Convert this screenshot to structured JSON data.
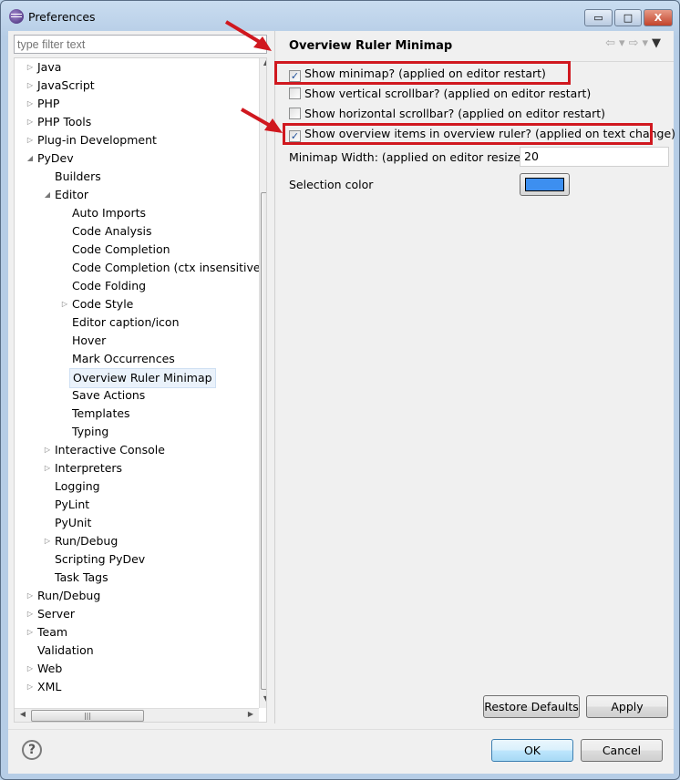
{
  "window": {
    "title": "Preferences",
    "minimize": "▭",
    "maximize": "□",
    "close": "X"
  },
  "filter": {
    "placeholder": "type filter text"
  },
  "tree": [
    {
      "label": "Java",
      "level": 0,
      "toggle": "collapsed"
    },
    {
      "label": "JavaScript",
      "level": 0,
      "toggle": "collapsed"
    },
    {
      "label": "PHP",
      "level": 0,
      "toggle": "collapsed"
    },
    {
      "label": "PHP Tools",
      "level": 0,
      "toggle": "collapsed"
    },
    {
      "label": "Plug-in Development",
      "level": 0,
      "toggle": "collapsed"
    },
    {
      "label": "PyDev",
      "level": 0,
      "toggle": "expanded"
    },
    {
      "label": "Builders",
      "level": 1,
      "toggle": "none"
    },
    {
      "label": "Editor",
      "level": 1,
      "toggle": "expanded"
    },
    {
      "label": "Auto Imports",
      "level": 2,
      "toggle": "none"
    },
    {
      "label": "Code Analysis",
      "level": 2,
      "toggle": "none"
    },
    {
      "label": "Code Completion",
      "level": 2,
      "toggle": "none"
    },
    {
      "label": "Code Completion (ctx insensitive a",
      "level": 2,
      "toggle": "none"
    },
    {
      "label": "Code Folding",
      "level": 2,
      "toggle": "none"
    },
    {
      "label": "Code Style",
      "level": 2,
      "toggle": "collapsed"
    },
    {
      "label": "Editor caption/icon",
      "level": 2,
      "toggle": "none"
    },
    {
      "label": "Hover",
      "level": 2,
      "toggle": "none"
    },
    {
      "label": "Mark Occurrences",
      "level": 2,
      "toggle": "none"
    },
    {
      "label": "Overview Ruler Minimap",
      "level": 2,
      "toggle": "none",
      "selected": true
    },
    {
      "label": "Save Actions",
      "level": 2,
      "toggle": "none"
    },
    {
      "label": "Templates",
      "level": 2,
      "toggle": "none"
    },
    {
      "label": "Typing",
      "level": 2,
      "toggle": "none"
    },
    {
      "label": "Interactive Console",
      "level": 1,
      "toggle": "collapsed"
    },
    {
      "label": "Interpreters",
      "level": 1,
      "toggle": "collapsed"
    },
    {
      "label": "Logging",
      "level": 1,
      "toggle": "none"
    },
    {
      "label": "PyLint",
      "level": 1,
      "toggle": "none"
    },
    {
      "label": "PyUnit",
      "level": 1,
      "toggle": "none"
    },
    {
      "label": "Run/Debug",
      "level": 1,
      "toggle": "collapsed"
    },
    {
      "label": "Scripting PyDev",
      "level": 1,
      "toggle": "none"
    },
    {
      "label": "Task Tags",
      "level": 1,
      "toggle": "none"
    },
    {
      "label": "Run/Debug",
      "level": 0,
      "toggle": "collapsed"
    },
    {
      "label": "Server",
      "level": 0,
      "toggle": "collapsed"
    },
    {
      "label": "Team",
      "level": 0,
      "toggle": "collapsed"
    },
    {
      "label": "Validation",
      "level": 0,
      "toggle": "none"
    },
    {
      "label": "Web",
      "level": 0,
      "toggle": "collapsed"
    },
    {
      "label": "XML",
      "level": 0,
      "toggle": "collapsed"
    }
  ],
  "page": {
    "title": "Overview Ruler Minimap",
    "options": [
      {
        "label": "Show minimap? (applied on editor restart)",
        "checked": true,
        "highlighted": true
      },
      {
        "label": "Show vertical scrollbar? (applied on editor restart)",
        "checked": false
      },
      {
        "label": "Show horizontal scrollbar? (applied on editor restart)",
        "checked": false
      },
      {
        "label": "Show overview items in overview ruler? (applied on text change)",
        "checked": true,
        "highlighted": true
      }
    ],
    "minimap_width_label": "Minimap Width: (applied on editor resize)",
    "minimap_width_value": "20",
    "selection_color_label": "Selection color",
    "selection_color": "#3d8ff0",
    "restore_defaults": "Restore Defaults",
    "apply": "Apply"
  },
  "footer": {
    "help": "?",
    "ok": "OK",
    "cancel": "Cancel"
  },
  "annotation_color": "#d0181f"
}
